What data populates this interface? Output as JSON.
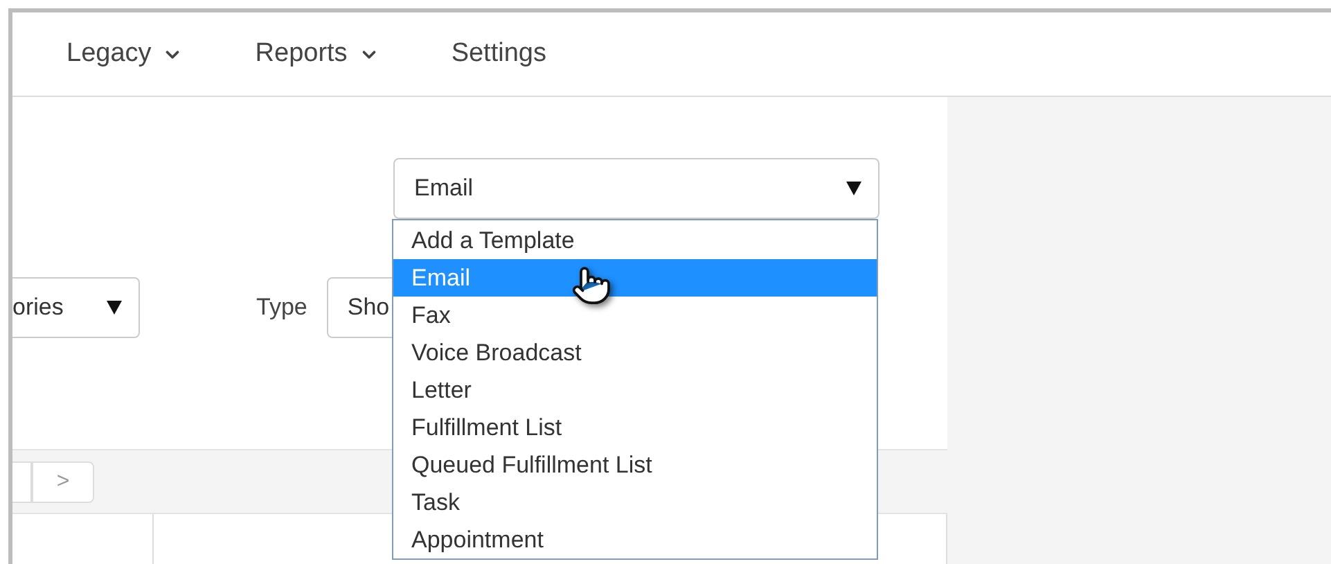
{
  "nav": {
    "items": [
      {
        "label": "Legacy",
        "has_menu": true
      },
      {
        "label": "Reports",
        "has_menu": true
      },
      {
        "label": "Settings",
        "has_menu": false
      }
    ]
  },
  "template_select": {
    "value": "Email",
    "expanded": true,
    "options": [
      {
        "label": "Add a Template",
        "selected": false
      },
      {
        "label": "Email",
        "selected": true
      },
      {
        "label": "Fax",
        "selected": false
      },
      {
        "label": "Voice Broadcast",
        "selected": false
      },
      {
        "label": "Letter",
        "selected": false
      },
      {
        "label": "Fulfillment List",
        "selected": false
      },
      {
        "label": "Queued Fulfillment List",
        "selected": false
      },
      {
        "label": "Task",
        "selected": false
      },
      {
        "label": "Appointment",
        "selected": false
      }
    ]
  },
  "filters": {
    "category_select": {
      "value": "ories"
    },
    "type_label": "Type",
    "type_select": {
      "value": "Sho"
    }
  },
  "pager": {
    "next": ">"
  }
}
